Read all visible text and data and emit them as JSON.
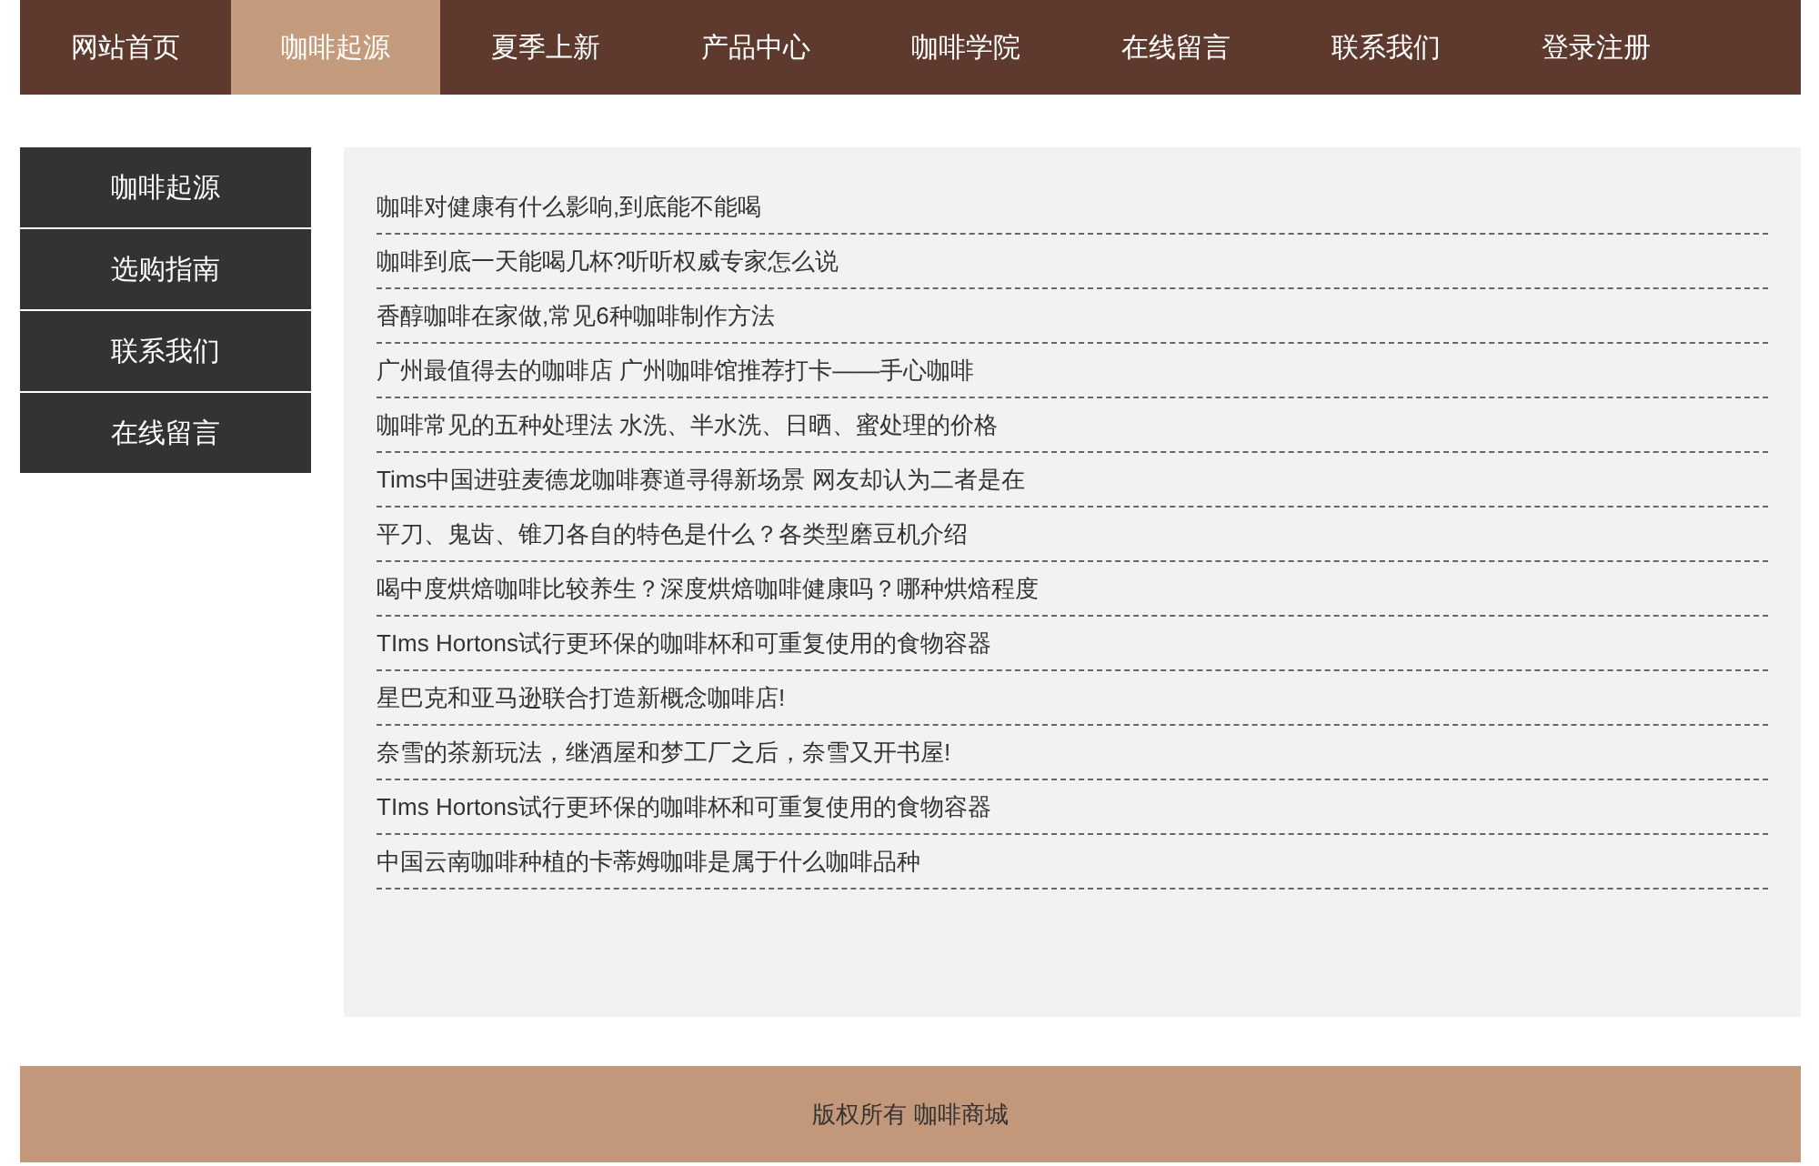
{
  "nav": [
    {
      "label": "网站首页",
      "selected": false
    },
    {
      "label": "咖啡起源",
      "selected": true
    },
    {
      "label": "夏季上新",
      "selected": false
    },
    {
      "label": "产品中心",
      "selected": false
    },
    {
      "label": "咖啡学院",
      "selected": false
    },
    {
      "label": "在线留言",
      "selected": false
    },
    {
      "label": "联系我们",
      "selected": false
    },
    {
      "label": "登录注册",
      "selected": false
    }
  ],
  "sidebar": {
    "items": [
      "咖啡起源",
      "选购指南",
      "联系我们",
      "在线留言"
    ]
  },
  "articles": [
    "咖啡对健康有什么影响,到底能不能喝",
    "咖啡到底一天能喝几杯?听听权威专家怎么说",
    "香醇咖啡在家做,常见6种咖啡制作方法",
    "广州最值得去的咖啡店 广州咖啡馆推荐打卡——手心咖啡",
    "咖啡常见的五种处理法 水洗、半水洗、日晒、蜜处理的价格",
    "Tims中国进驻麦德龙咖啡赛道寻得新场景 网友却认为二者是在",
    "平刀、鬼齿、锥刀各自的特色是什么？各类型磨豆机介绍",
    "喝中度烘焙咖啡比较养生？深度烘焙咖啡健康吗？哪种烘焙程度",
    "TIms Hortons试行更环保的咖啡杯和可重复使用的食物容器",
    "星巴克和亚马逊联合打造新概念咖啡店!",
    "奈雪的茶新玩法，继酒屋和梦工厂之后，奈雪又开书屋!",
    "TIms Hortons试行更环保的咖啡杯和可重复使用的食物容器",
    "中国云南咖啡种植的卡蒂姆咖啡是属于什么咖啡品种"
  ],
  "footer": "版权所有 咖啡商城"
}
